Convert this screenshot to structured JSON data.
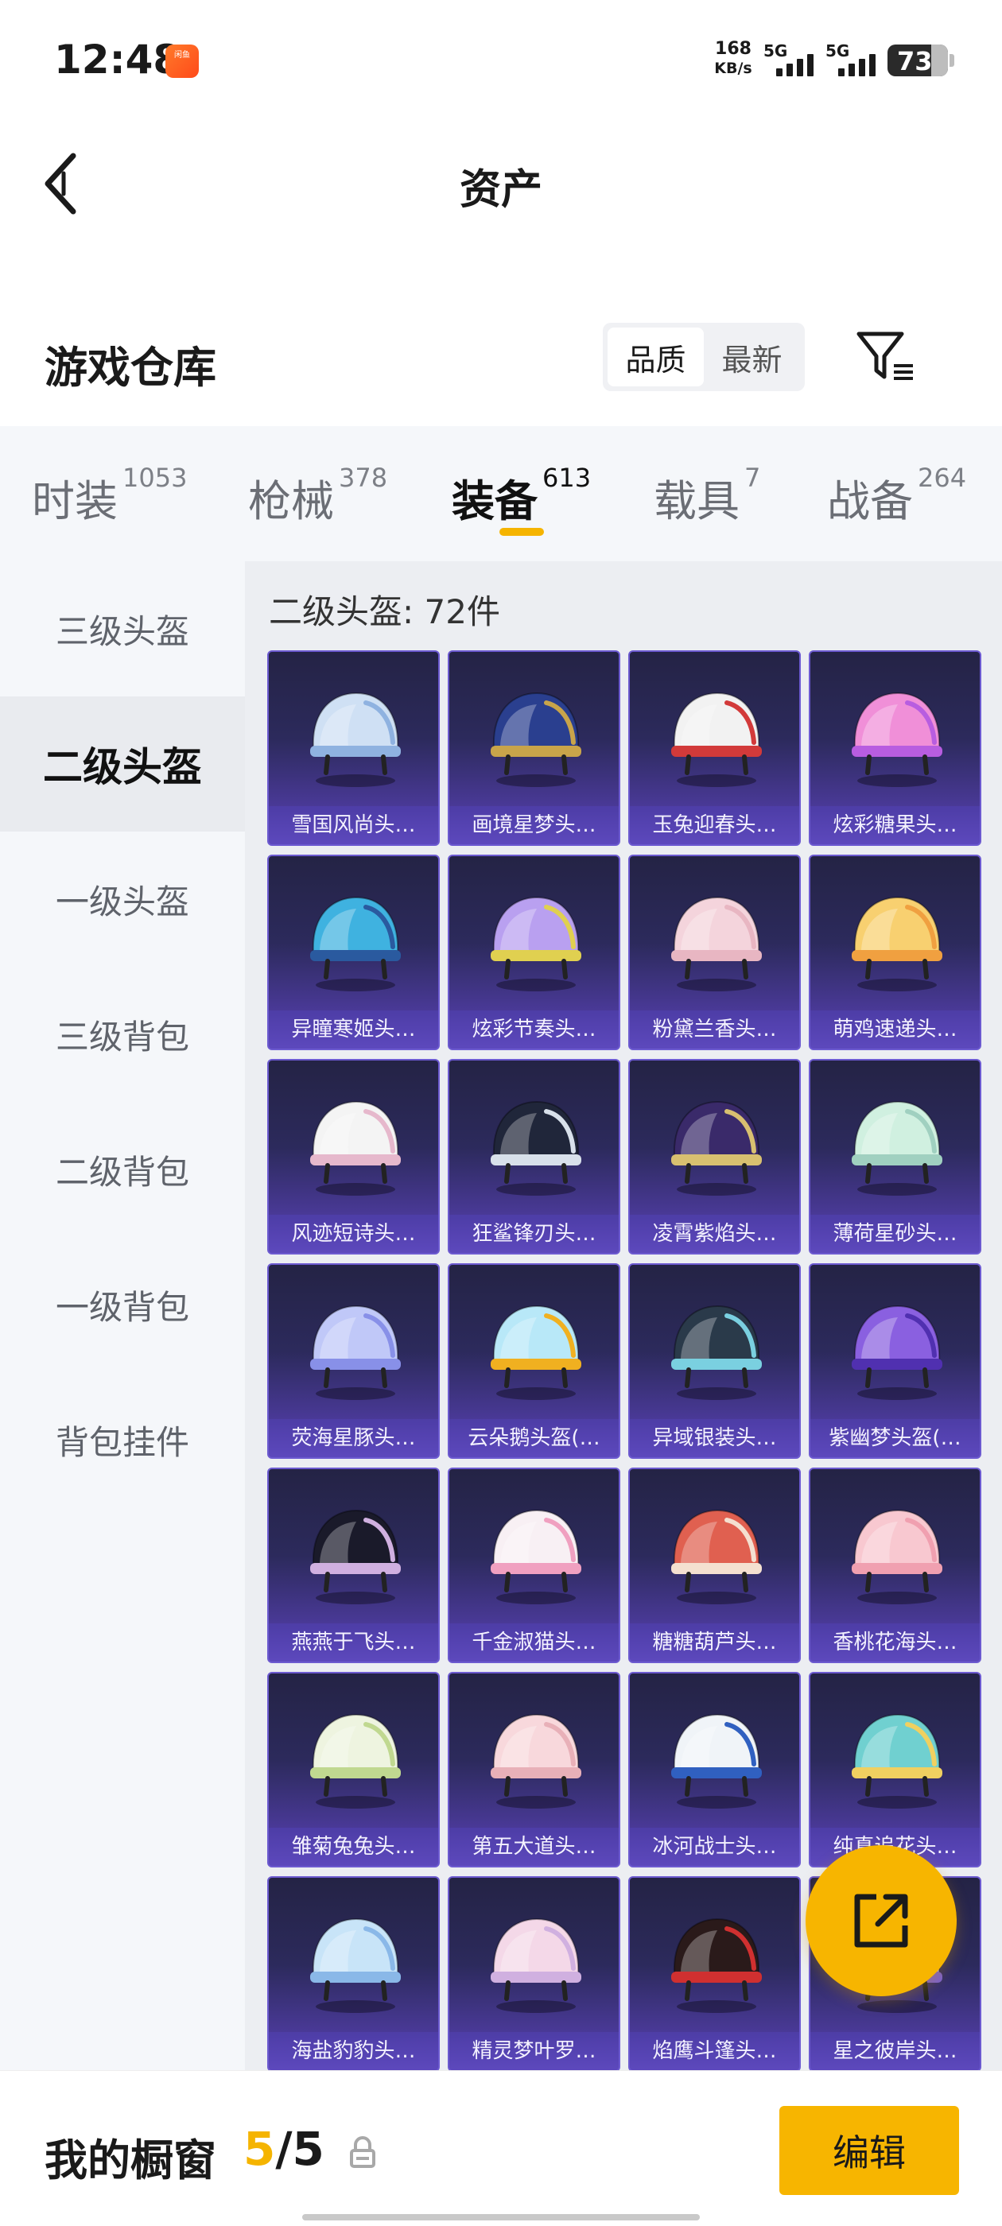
{
  "status_bar": {
    "time": "12:48",
    "app_icon": "闲鱼",
    "net_speed_value": "168",
    "net_speed_unit": "KB/s",
    "signal_1": "5G",
    "signal_2": "5G",
    "battery": "73",
    "battery_level_percent": 73
  },
  "header": {
    "title": "资产",
    "back_icon": "back-arrow-icon"
  },
  "warehouse": {
    "title": "游戏仓库",
    "sort_options": [
      "品质",
      "最新"
    ],
    "active_sort": "品质",
    "filter_icon": "filter-icon"
  },
  "tabs": [
    {
      "label": "时装",
      "count": "1053",
      "active": false
    },
    {
      "label": "枪械",
      "count": "378",
      "active": false
    },
    {
      "label": "装备",
      "count": "613",
      "active": true
    },
    {
      "label": "载具",
      "count": "7",
      "active": false
    },
    {
      "label": "战备",
      "count": "264",
      "active": false
    }
  ],
  "sidebar": {
    "items": [
      "三级头盔",
      "二级头盔",
      "一级头盔",
      "三级背包",
      "二级背包",
      "一级背包",
      "背包挂件"
    ],
    "active_index": 1
  },
  "content": {
    "header": "二级头盔: 72件",
    "items": [
      {
        "name": "雪国风尚头…",
        "colors": [
          "#cfe0f4",
          "#8fb2e0"
        ]
      },
      {
        "name": "画境星梦头…",
        "colors": [
          "#2a3f8f",
          "#c8a44a"
        ]
      },
      {
        "name": "玉兔迎春头…",
        "colors": [
          "#f2f2f2",
          "#d23a3a"
        ]
      },
      {
        "name": "炫彩糖果头…",
        "colors": [
          "#f08fd8",
          "#b85de0"
        ]
      },
      {
        "name": "异瞳寒姬头…",
        "colors": [
          "#3fb2e0",
          "#2a5a9f"
        ]
      },
      {
        "name": "炫彩节奏头…",
        "colors": [
          "#b9a0f0",
          "#e0d050"
        ]
      },
      {
        "name": "粉黛兰香头…",
        "colors": [
          "#f4d4dc",
          "#e8b6c2"
        ]
      },
      {
        "name": "萌鸡速递头…",
        "colors": [
          "#f8d070",
          "#f0a040"
        ]
      },
      {
        "name": "风迹短诗头…",
        "colors": [
          "#f4f4f4",
          "#e6b8cc"
        ]
      },
      {
        "name": "狂鲨锋刃头…",
        "colors": [
          "#20263a",
          "#d8e0ea"
        ]
      },
      {
        "name": "凌霄紫焰头…",
        "colors": [
          "#3a2a6a",
          "#d8c070"
        ]
      },
      {
        "name": "薄荷星砂头…",
        "colors": [
          "#d0f0e0",
          "#a0d0c0"
        ]
      },
      {
        "name": "荧海星豚头…",
        "colors": [
          "#c0c8f8",
          "#8890e8"
        ]
      },
      {
        "name": "云朵鹅头盔(…",
        "colors": [
          "#b8e8f8",
          "#f0b020"
        ]
      },
      {
        "name": "异域银装头…",
        "colors": [
          "#2a3a4a",
          "#7ad0e0"
        ]
      },
      {
        "name": "紫幽梦头盔(…",
        "colors": [
          "#8a60e0",
          "#5030b0"
        ]
      },
      {
        "name": "燕燕于飞头…",
        "colors": [
          "#1a1a2a",
          "#d0b0e0"
        ]
      },
      {
        "name": "千金淑猫头…",
        "colors": [
          "#f8f0f4",
          "#f0a0c0"
        ]
      },
      {
        "name": "糖糖葫芦头…",
        "colors": [
          "#e06050",
          "#f4e0d0"
        ]
      },
      {
        "name": "香桃花海头…",
        "colors": [
          "#f8c8d0",
          "#f0a0b0"
        ]
      },
      {
        "name": "雏菊兔兔头…",
        "colors": [
          "#eef4e0",
          "#c0d890"
        ]
      },
      {
        "name": "第五大道头…",
        "colors": [
          "#f8d8dc",
          "#e8b0b8"
        ]
      },
      {
        "name": "冰河战士头…",
        "colors": [
          "#f0f4f8",
          "#3060c0"
        ]
      },
      {
        "name": "纯真追花头…",
        "colors": [
          "#70d0d0",
          "#f0d060"
        ]
      },
      {
        "name": "海盐豹豹头…",
        "colors": [
          "#c8e4f8",
          "#8ab8e8"
        ]
      },
      {
        "name": "精灵梦叶罗…",
        "colors": [
          "#f4d8e8",
          "#d0b0e0"
        ]
      },
      {
        "name": "焰鹰斗篷头…",
        "colors": [
          "#2a1a1a",
          "#d03030"
        ]
      },
      {
        "name": "星之彼岸头…",
        "colors": [
          "#b0a0f0",
          "#7a60d0"
        ]
      }
    ]
  },
  "fab": {
    "icon": "share-external-icon"
  },
  "bottom_bar": {
    "label": "我的橱窗",
    "current": "5",
    "separator": "/",
    "max": "5",
    "lock_icon": "lock-icon",
    "edit_label": "编辑"
  },
  "colors": {
    "accent": "#f7b500",
    "card_bg": "#2c2a5c",
    "card_border": "#6c5ad0"
  }
}
